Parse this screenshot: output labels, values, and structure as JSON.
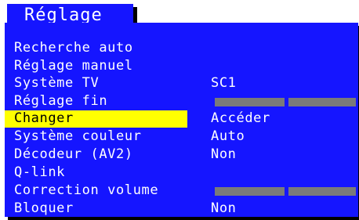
{
  "title": "Réglage",
  "colors": {
    "panel": "#1515ff",
    "text": "#ffffff",
    "highlight": "#ffff00",
    "bar": "#7a7a7a"
  },
  "menu": {
    "items": [
      {
        "label": "Recherche auto",
        "value": ""
      },
      {
        "label": "Réglage manuel",
        "value": ""
      },
      {
        "label": "Système TV",
        "value": "SC1"
      },
      {
        "label": "Réglage fin",
        "value": "",
        "bar": 1.0
      },
      {
        "label": "Changer",
        "value": "Accéder",
        "selected": true
      },
      {
        "label": "Système couleur",
        "value": "Auto"
      },
      {
        "label": "Décodeur (AV2)",
        "value": "Non"
      },
      {
        "label": "Q-link",
        "value": ""
      },
      {
        "label": "Correction volume",
        "value": "",
        "bar": 1.0
      },
      {
        "label": "Bloquer",
        "value": "Non"
      }
    ]
  }
}
